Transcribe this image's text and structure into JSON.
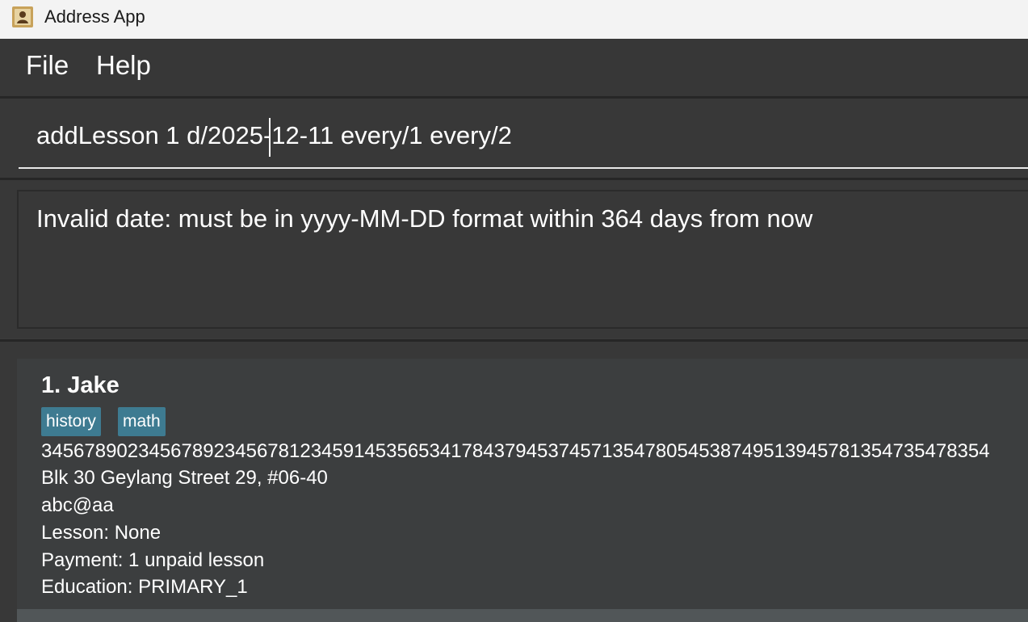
{
  "window": {
    "title": "Address App"
  },
  "menu": {
    "items": [
      "File",
      "Help"
    ]
  },
  "command": {
    "value": "addLesson 1 d/2025-12-11 every/1 every/2"
  },
  "result": {
    "message": "Invalid date: must be in yyyy-MM-DD format within 364 days from now"
  },
  "persons": [
    {
      "name": "1. Jake",
      "tags": [
        "history",
        "math"
      ],
      "phone": "3456789023456789234567812345914535653417843794537457135478054538749513945781354735478354",
      "address": "Blk 30 Geylang Street 29, #06-40",
      "email": "abc@aa",
      "lesson": "Lesson: None",
      "payment": "Payment: 1 unpaid lesson",
      "education": "Education: PRIMARY_1"
    }
  ],
  "colors": {
    "tag_bg": "#3e7b91",
    "background": "#383838",
    "card_bg": "#3c3e3f"
  },
  "icons": {
    "app": "address-book-icon"
  }
}
